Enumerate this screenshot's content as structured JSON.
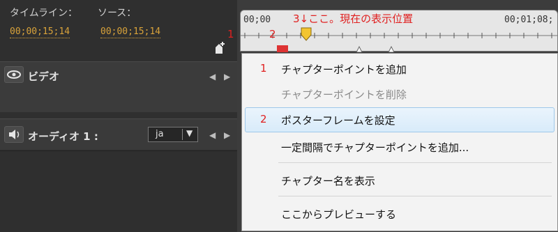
{
  "header": {
    "timeline_label": "タイムライン：",
    "source_label": "ソース：",
    "timeline_time": "00;00;15;14",
    "source_time": "00;00;15;14"
  },
  "ruler": {
    "start_time": "00;00",
    "end_time": "00;01;08;"
  },
  "annotations": {
    "a1": "1",
    "a2": "2",
    "a3": "3↓ここ。現在の表示位置"
  },
  "tracks": {
    "video": "ビデオ",
    "audio": "オーディオ 1 :",
    "audio_lang": "ja",
    "nav_arrows": "◀ ▶"
  },
  "menu": {
    "items": [
      {
        "num": "1",
        "label": "チャプターポイントを追加",
        "state": "normal"
      },
      {
        "num": "",
        "label": "チャプターポイントを削除",
        "state": "disabled"
      },
      {
        "num": "2",
        "label": "ポスターフレームを設定",
        "state": "selected"
      },
      {
        "num": "",
        "label": "一定間隔でチャプターポイントを追加...",
        "state": "normal"
      },
      {
        "num": "",
        "label": "チャプター名を表示",
        "state": "normal"
      },
      {
        "num": "",
        "label": "ここからプレビューする",
        "state": "normal"
      }
    ]
  },
  "icons": {
    "eye": "eye-icon",
    "speaker": "speaker-icon",
    "add_marker": "add-marker-icon",
    "playhead": "playhead-icon"
  },
  "colors": {
    "timecode": "#d8a23a",
    "annotation": "#e02020",
    "selected_bg": "#d8ebfa"
  }
}
